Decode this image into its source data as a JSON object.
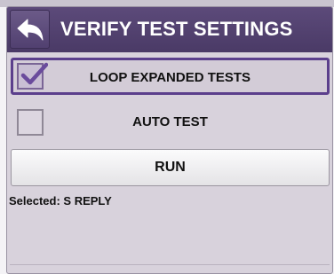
{
  "dialog": {
    "title": "VERIFY TEST SETTINGS",
    "back_icon": "back-arrow-icon"
  },
  "options": [
    {
      "label": "LOOP EXPANDED TESTS",
      "checked": true,
      "highlighted": true
    },
    {
      "label": "AUTO TEST",
      "checked": false,
      "highlighted": false
    }
  ],
  "run_button": {
    "label": "RUN"
  },
  "status": {
    "selected_text": "Selected: S REPLY"
  },
  "colors": {
    "titlebar": "#4a3a66",
    "accent": "#5b3f8c",
    "dialog_bg": "#d8d2dc"
  }
}
